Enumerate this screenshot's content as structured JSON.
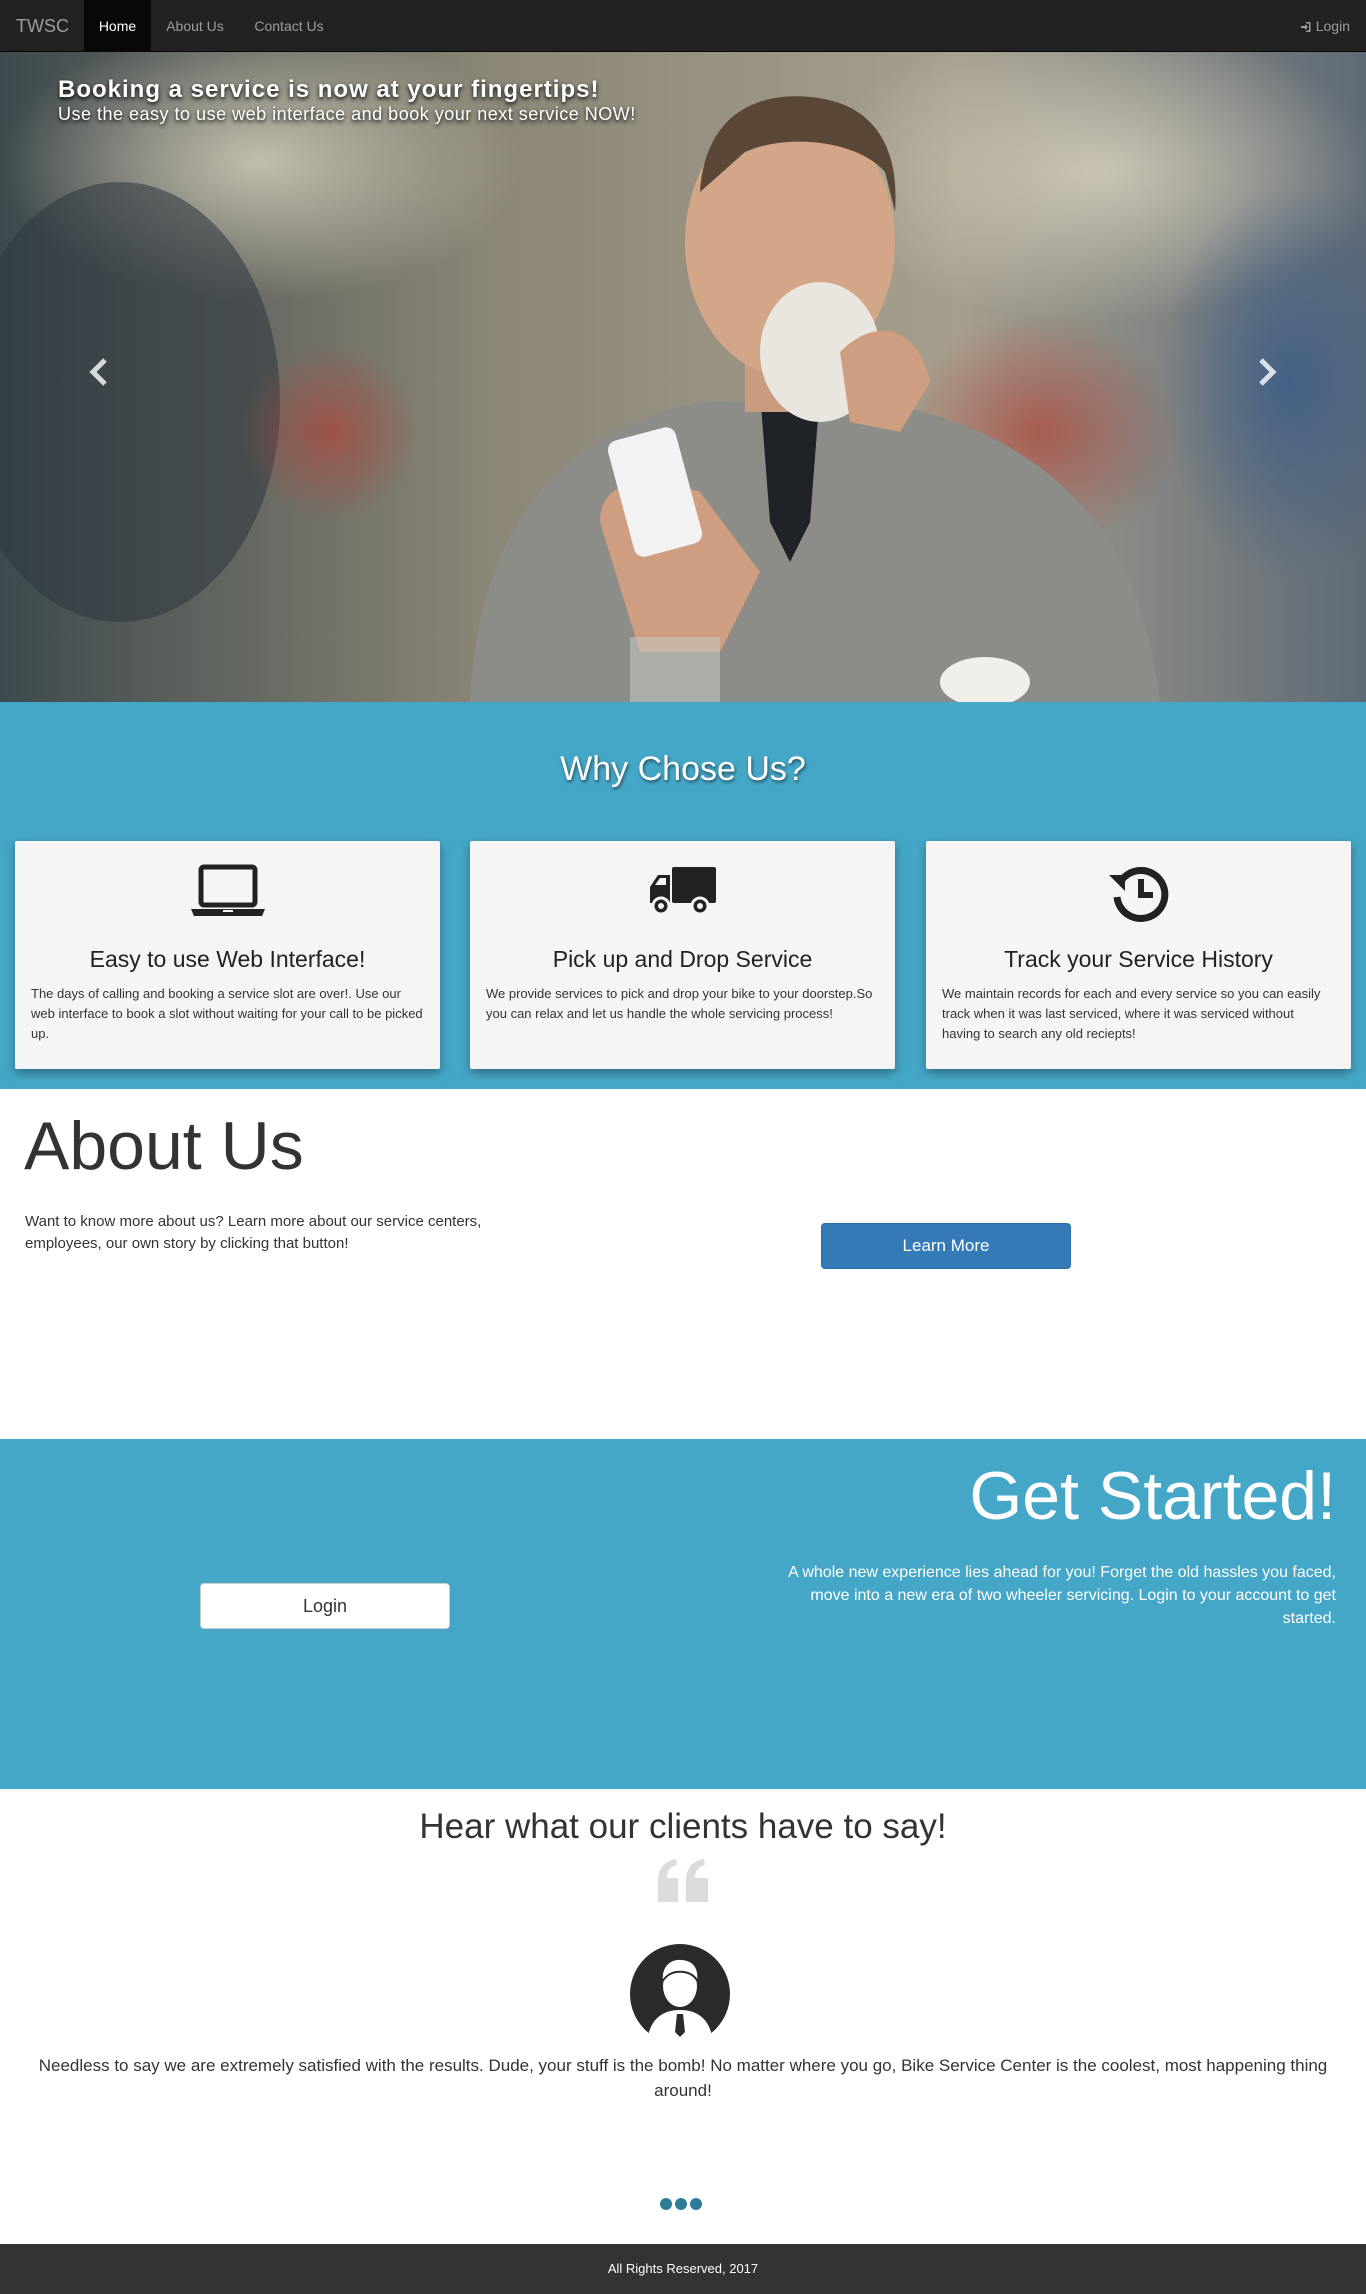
{
  "navbar": {
    "brand": "TWSC",
    "items": [
      "Home",
      "About Us",
      "Contact Us"
    ],
    "login": "Login"
  },
  "carousel": {
    "caption_title": "Booking a service is now at your fingertips!",
    "caption_sub": "Use the easy to use web interface and book your next service NOW!"
  },
  "why": {
    "title": "Why Chose Us?",
    "cards": [
      {
        "icon": "laptop-icon",
        "title": "Easy to use Web Interface!",
        "text": "The days of calling and booking a service slot are over!. Use our web interface to book a slot without waiting for your call to be picked up."
      },
      {
        "icon": "truck-icon",
        "title": "Pick up and Drop Service",
        "text": "We provide services to pick and drop your bike to your doorstep.So you can relax and let us handle the whole servicing process!"
      },
      {
        "icon": "history-icon",
        "title": "Track your Service History",
        "text": "We maintain records for each and every service so you can easily track when it was last serviced, where it was serviced without having to search any old reciepts!"
      }
    ]
  },
  "about": {
    "title": "About Us",
    "text": "Want to know more about us? Learn more about our service centers, employees, our own story by clicking that button!",
    "button": "Learn More"
  },
  "started": {
    "title": "Get Started!",
    "text": "A whole new experience lies ahead for you! Forget the old hassles you faced, move into a new era of two wheeler servicing. Login to your account to get started.",
    "button": "Login"
  },
  "testimonials": {
    "title": "Hear what our clients have to say!",
    "quote": "Needless to say we are extremely satisfied with the results. Dude, your stuff is the bomb! No matter where you go, Bike Service Center is the coolest, most happening thing around!"
  },
  "footer": {
    "text": "All Rights Reserved, 2017"
  },
  "colors": {
    "accent": "#45a7c7",
    "navbar": "#222222",
    "button_primary": "#337ab7",
    "footer": "#333333"
  }
}
